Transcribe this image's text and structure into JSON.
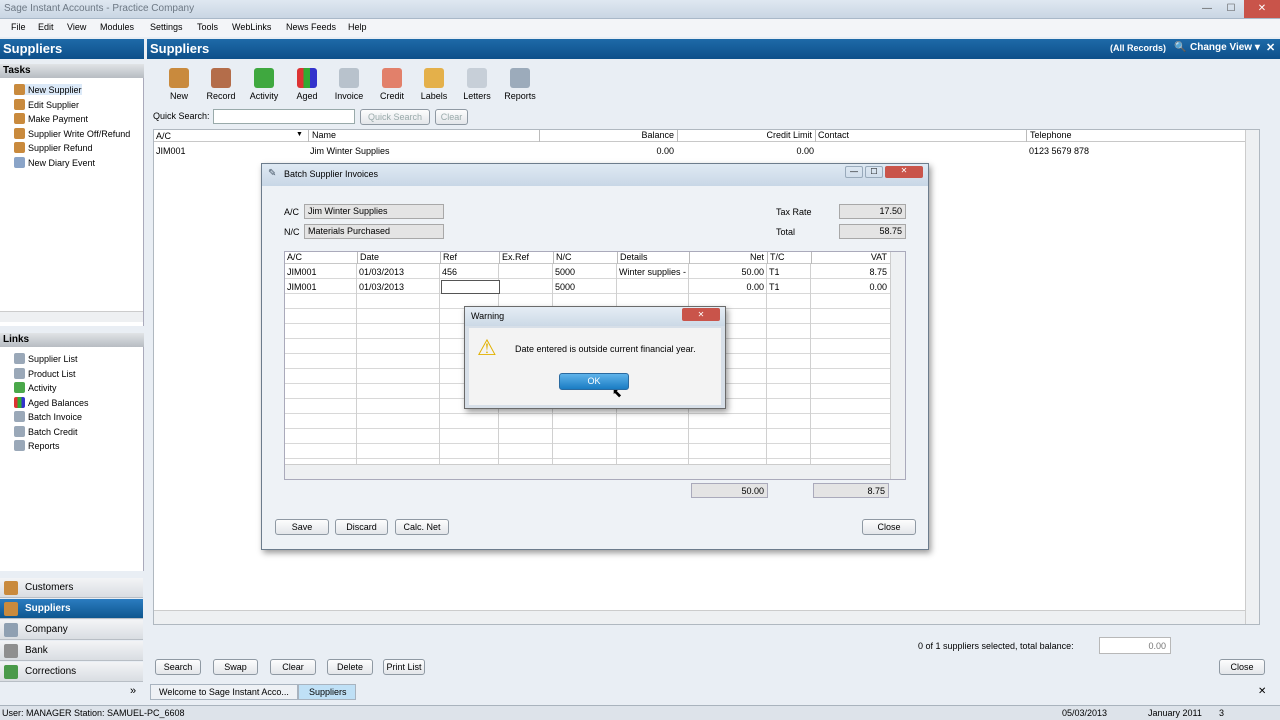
{
  "app": {
    "title": "Sage Instant Accounts - Practice Company"
  },
  "menu": [
    "File",
    "Edit",
    "View",
    "Modules",
    "Settings",
    "Tools",
    "WebLinks",
    "News Feeds",
    "Help"
  ],
  "left": {
    "header": "Suppliers",
    "tasks_title": "Tasks",
    "tasks": [
      "New Supplier",
      "Edit Supplier",
      "Make Payment",
      "Supplier Write Off/Refund",
      "Supplier Refund",
      "New Diary Event"
    ],
    "links_title": "Links",
    "links": [
      "Supplier List",
      "Product List",
      "Activity",
      "Aged Balances",
      "Batch Invoice",
      "Batch Credit",
      "Reports"
    ],
    "nav": [
      "Customers",
      "Suppliers",
      "Company",
      "Bank",
      "Corrections"
    ],
    "more": "»"
  },
  "main": {
    "header": "Suppliers",
    "all_records": "(All Records)",
    "change_view": "Change View ▾",
    "toolbar": [
      "New",
      "Record",
      "Activity",
      "Aged",
      "Invoice",
      "Credit",
      "Labels",
      "Letters",
      "Reports"
    ],
    "quick_search_label": "Quick Search:",
    "quick_search_btn": "Quick Search",
    "clear_btn": "Clear",
    "columns": [
      "A/C",
      "Name",
      "Balance",
      "Credit Limit",
      "Contact",
      "Telephone"
    ],
    "rows": [
      {
        "ac": "JIM001",
        "name": "Jim Winter Supplies",
        "balance": "0.00",
        "credit": "0.00",
        "contact": "",
        "tel": "0123 5679 878"
      }
    ],
    "selection_text": "0 of 1 suppliers selected, total balance:",
    "total_balance": "0.00",
    "bottom_buttons": [
      "Search",
      "Swap",
      "Clear",
      "Delete",
      "Print List"
    ],
    "close_btn": "Close"
  },
  "tabs": [
    "Welcome to Sage Instant Acco...",
    "Suppliers"
  ],
  "status": {
    "user": "User: MANAGER Station: SAMUEL-PC_6608",
    "date": "05/03/2013",
    "period": "January 2011",
    "num": "3"
  },
  "dialog": {
    "title": "Batch Supplier Invoices",
    "ac_label": "A/C",
    "ac_value": "Jim Winter Supplies",
    "nc_label": "N/C",
    "nc_value": "Materials Purchased",
    "tax_rate_label": "Tax Rate",
    "tax_rate": "17.50",
    "total_label": "Total",
    "total": "58.75",
    "columns": [
      "A/C",
      "Date",
      "Ref",
      "Ex.Ref",
      "N/C",
      "Details",
      "Net",
      "T/C",
      "VAT"
    ],
    "rows": [
      [
        "JIM001",
        "01/03/2013",
        "456",
        "",
        "5000",
        "Winter supplies -...",
        "50.00",
        "T1",
        "8.75"
      ],
      [
        "JIM001",
        "01/03/2013",
        "",
        "",
        "5000",
        "",
        "0.00",
        "T1",
        "0.00"
      ]
    ],
    "net_total": "50.00",
    "vat_total": "8.75",
    "buttons": [
      "Save",
      "Discard",
      "Calc. Net"
    ],
    "close": "Close"
  },
  "warning": {
    "title": "Warning",
    "message": "Date entered is outside current financial year.",
    "ok": "OK"
  }
}
